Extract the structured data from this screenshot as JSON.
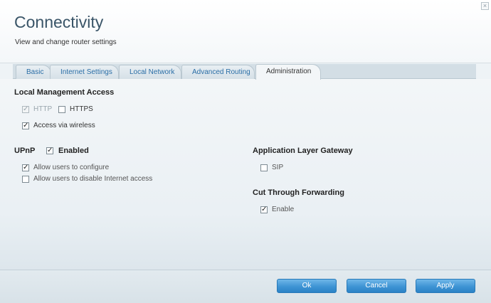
{
  "header": {
    "title": "Connectivity",
    "subtitle": "View and change router settings",
    "close_glyph": "×"
  },
  "tabs": [
    {
      "label": "Basic",
      "active": false
    },
    {
      "label": "Internet Settings",
      "active": false
    },
    {
      "label": "Local Network",
      "active": false
    },
    {
      "label": "Advanced Routing",
      "active": false
    },
    {
      "label": "Administration",
      "active": true
    }
  ],
  "local_management": {
    "heading": "Local Management Access",
    "http": {
      "label": "HTTP",
      "checked": true,
      "disabled": true
    },
    "https": {
      "label": "HTTPS",
      "checked": false,
      "disabled": false
    },
    "wireless": {
      "label": "Access via wireless",
      "checked": true
    }
  },
  "upnp": {
    "heading": "UPnP",
    "enabled": {
      "label": "Enabled",
      "checked": true
    },
    "allow_configure": {
      "label": "Allow users to configure",
      "checked": true
    },
    "allow_disable": {
      "label": "Allow users to disable Internet access",
      "checked": false
    }
  },
  "alg": {
    "heading": "Application Layer Gateway",
    "sip": {
      "label": "SIP",
      "checked": false
    }
  },
  "ctf": {
    "heading": "Cut Through Forwarding",
    "enable": {
      "label": "Enable",
      "checked": true
    }
  },
  "footer": {
    "ok": "Ok",
    "cancel": "Cancel",
    "apply": "Apply"
  },
  "check_glyph": "✓",
  "colors": {
    "accent": "#3e94d4",
    "tab_text": "#2a6ea6",
    "title": "#3a5568"
  }
}
